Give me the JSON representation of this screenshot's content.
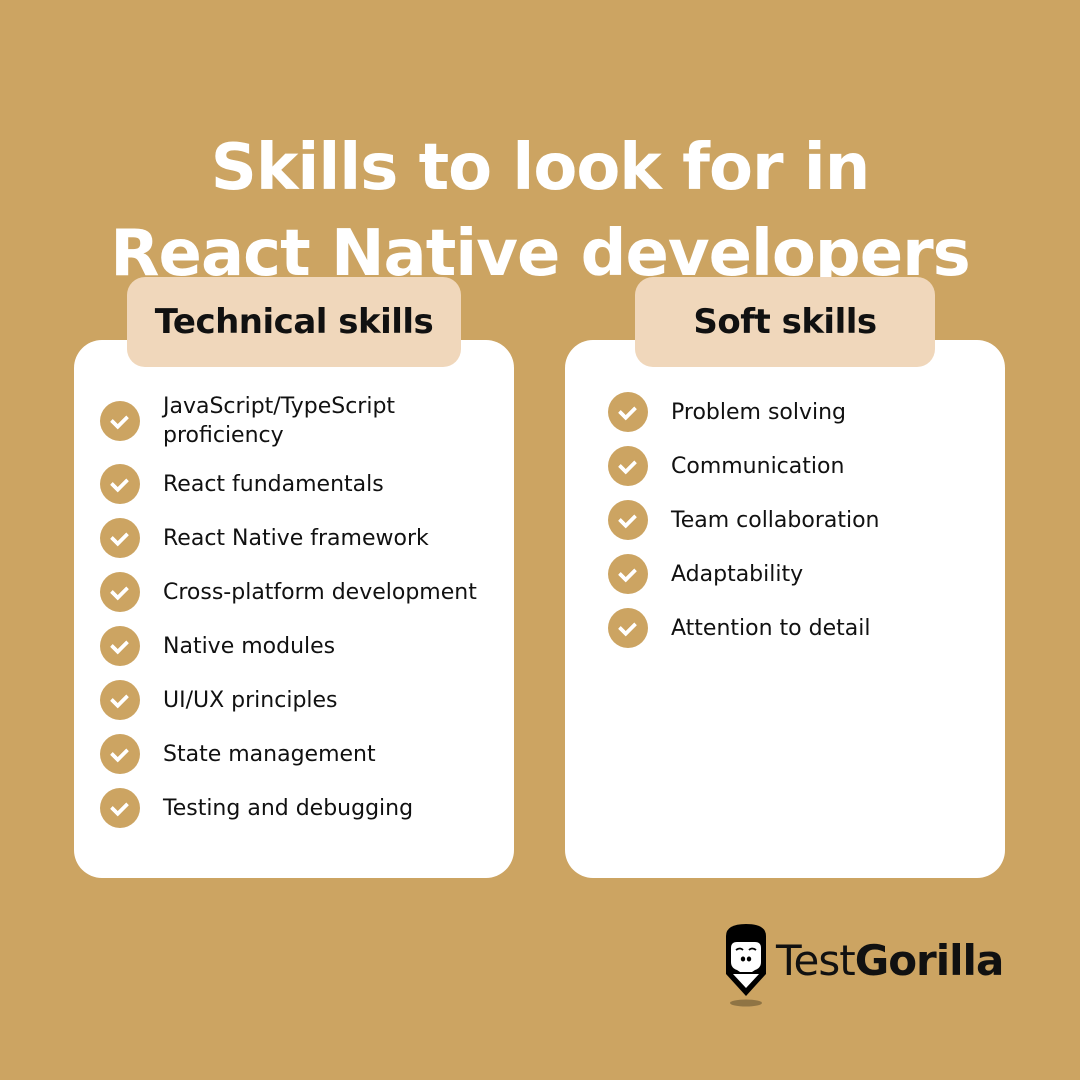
{
  "title": {
    "line1": "Skills to look for in",
    "line2": "React Native developers"
  },
  "colors": {
    "background": "#cca462",
    "card": "#ffffff",
    "tag": "#f0d7bb",
    "check": "#cca462",
    "text": "#111111"
  },
  "technical": {
    "heading": "Technical skills",
    "items": [
      {
        "label": "JavaScript/TypeScript proficiency",
        "icon": "check-circle-icon"
      },
      {
        "label": "React fundamentals",
        "icon": "check-circle-icon"
      },
      {
        "label": "React Native framework",
        "icon": "check-circle-icon"
      },
      {
        "label": "Cross-platform development",
        "icon": "check-circle-icon"
      },
      {
        "label": "Native modules",
        "icon": "check-circle-icon"
      },
      {
        "label": "UI/UX principles",
        "icon": "check-circle-icon"
      },
      {
        "label": "State management",
        "icon": "check-circle-icon"
      },
      {
        "label": "Testing and debugging",
        "icon": "check-circle-icon"
      }
    ]
  },
  "soft": {
    "heading": "Soft skills",
    "items": [
      {
        "label": "Problem solving",
        "icon": "check-circle-icon"
      },
      {
        "label": "Communication",
        "icon": "check-circle-icon"
      },
      {
        "label": "Team collaboration",
        "icon": "check-circle-icon"
      },
      {
        "label": "Adaptability",
        "icon": "check-circle-icon"
      },
      {
        "label": "Attention to detail",
        "icon": "check-circle-icon"
      }
    ]
  },
  "brand": {
    "name_light": "Test",
    "name_bold": "Gorilla",
    "icon": "gorilla-pencil-logo-icon"
  }
}
